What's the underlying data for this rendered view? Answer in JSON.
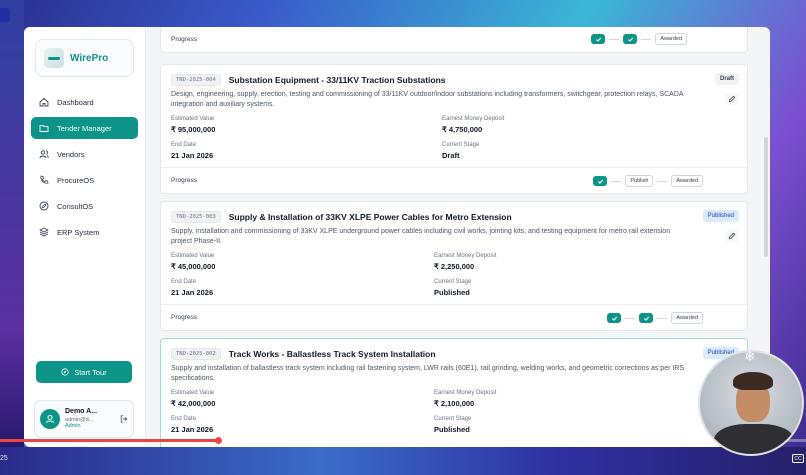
{
  "app": {
    "brand": "WirePro"
  },
  "sidebar": {
    "items": [
      {
        "label": "Dashboard",
        "icon": "home-icon",
        "active": false
      },
      {
        "label": "Tender Manager",
        "icon": "folder-icon",
        "active": true
      },
      {
        "label": "Vendors",
        "icon": "users-icon",
        "active": false
      },
      {
        "label": "ProcureOS",
        "icon": "phone-icon",
        "active": false
      },
      {
        "label": "ConsultOS",
        "icon": "compass-icon",
        "active": false
      },
      {
        "label": "ERP System",
        "icon": "layers-icon",
        "active": false
      }
    ],
    "start_tour": "Start Tour",
    "user": {
      "name": "Demo A...",
      "email": "admin@d...",
      "role": "Admin"
    }
  },
  "labels": {
    "progress": "Progress",
    "estimated_value": "Estimated Value",
    "earnest_money": "Earnest Money Deposit",
    "end_date": "End Date",
    "current_stage": "Current Stage",
    "publish": "Publish",
    "awarded": "Awarded"
  },
  "tenders": [
    {
      "id": "TND-2025-004",
      "title": "Substation Equipment - 33/11KV Traction Substations",
      "status": "Draft",
      "description": "Design, engineering, supply, erection, testing and commissioning of 33/11KV outdoor/indoor substations including transformers, switchgear, protection relays, SCADA integration and auxiliary systems.",
      "estimated_value": "₹ 95,000,000",
      "emd": "₹ 4,750,000",
      "end_date": "21 Jan 2026",
      "stage": "Draft"
    },
    {
      "id": "TND-2025-003",
      "title": "Supply & Installation of 33KV XLPE Power Cables for Metro Extension",
      "status": "Published",
      "description": "Supply, installation and commissioning of 33KV XLPE underground power cables including civil works, jointing kits, and testing equipment for metro rail extension project Phase-II.",
      "estimated_value": "₹ 45,000,000",
      "emd": "₹ 2,250,000",
      "end_date": "21 Jan 2026",
      "stage": "Published"
    },
    {
      "id": "TND-2025-002",
      "title": "Track Works - Ballastless Track System Installation",
      "status": "Published",
      "description": "Supply and installation of ballastless track system including rail fastening system, LWR rails (60E1), rail grinding, welding works, and geometric corrections as per IRS specifications.",
      "estimated_value": "₹ 42,000,000",
      "emd": "₹ 2,100,000",
      "end_date": "21 Jan 2026",
      "stage": "Published"
    }
  ],
  "video": {
    "time": "25",
    "progress": 0.27,
    "cc": "CC"
  },
  "colors": {
    "accent": "#0d9488",
    "published_bg": "#dbeafe",
    "published_text": "#1e40af"
  }
}
